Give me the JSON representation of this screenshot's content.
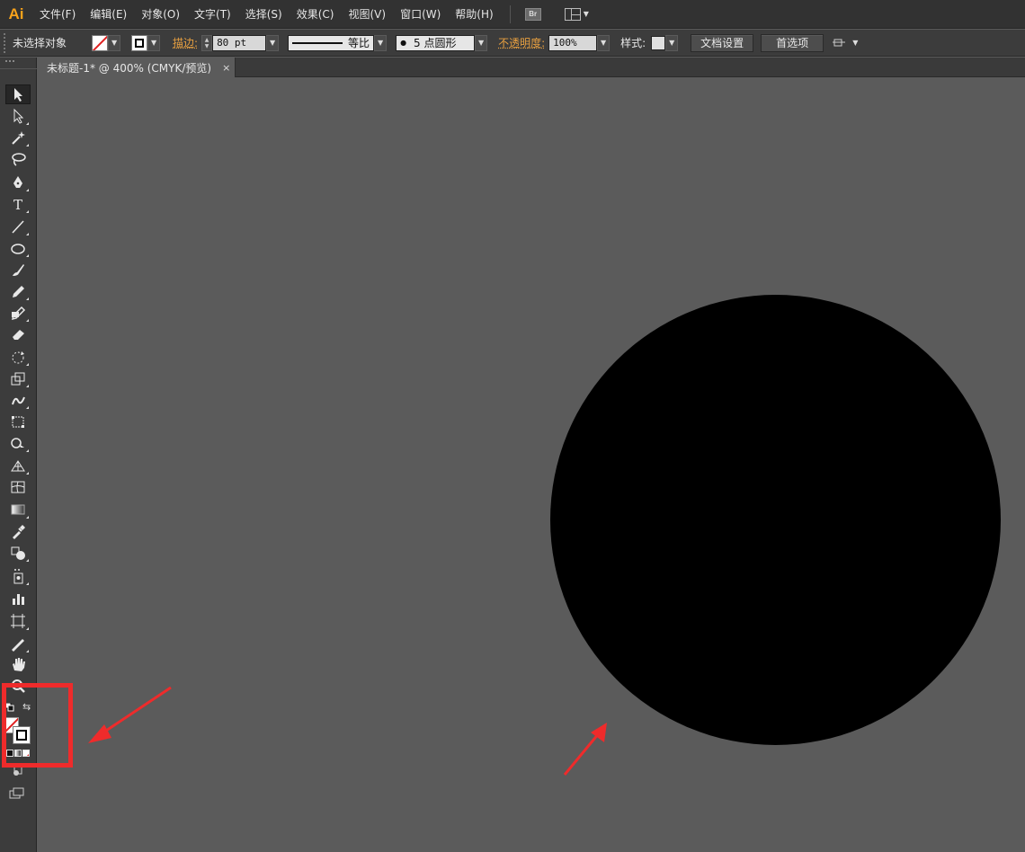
{
  "app": {
    "logo": "Ai"
  },
  "menu": {
    "items": [
      "文件(F)",
      "编辑(E)",
      "对象(O)",
      "文字(T)",
      "选择(S)",
      "效果(C)",
      "视图(V)",
      "窗口(W)",
      "帮助(H)"
    ],
    "bridge_label": "Br"
  },
  "control": {
    "selection": "未选择对象",
    "stroke_label": "描边:",
    "stroke_value": "80 pt",
    "profile_label": "等比",
    "brush_label": "5 点圆形",
    "brush_dot": "●",
    "opacity_label": "不透明度:",
    "opacity_value": "100%",
    "style_label": "样式:",
    "doc_setup": "文档设置",
    "preferences": "首选项"
  },
  "document": {
    "tab_title": "未标题-1* @ 400% (CMYK/预览)",
    "close": "×"
  },
  "colors": {
    "accent": "#f7a21b",
    "annotation": "#ef2b2b",
    "circle": "#000000",
    "canvas": "#5b5b5b"
  },
  "tools": [
    {
      "name": "selection-tool-icon"
    },
    {
      "name": "direct-selection-tool-icon"
    },
    {
      "name": "magic-wand-tool-icon"
    },
    {
      "name": "lasso-tool-icon"
    },
    {
      "name": "pen-tool-icon"
    },
    {
      "name": "type-tool-icon",
      "glyph": "T"
    },
    {
      "name": "line-tool-icon"
    },
    {
      "name": "ellipse-tool-icon"
    },
    {
      "name": "paintbrush-tool-icon"
    },
    {
      "name": "pencil-tool-icon"
    },
    {
      "name": "blob-brush-tool-icon"
    },
    {
      "name": "eraser-tool-icon"
    },
    {
      "name": "rotate-tool-icon"
    },
    {
      "name": "scale-tool-icon"
    },
    {
      "name": "warp-tool-icon"
    },
    {
      "name": "free-transform-tool-icon"
    },
    {
      "name": "shape-builder-tool-icon"
    },
    {
      "name": "perspective-grid-tool-icon"
    },
    {
      "name": "mesh-tool-icon"
    },
    {
      "name": "gradient-tool-icon"
    },
    {
      "name": "eyedropper-tool-icon"
    },
    {
      "name": "blend-tool-icon"
    },
    {
      "name": "symbol-sprayer-tool-icon"
    },
    {
      "name": "column-graph-tool-icon"
    },
    {
      "name": "artboard-tool-icon"
    },
    {
      "name": "slice-tool-icon"
    },
    {
      "name": "hand-tool-icon"
    },
    {
      "name": "zoom-tool-icon"
    }
  ]
}
